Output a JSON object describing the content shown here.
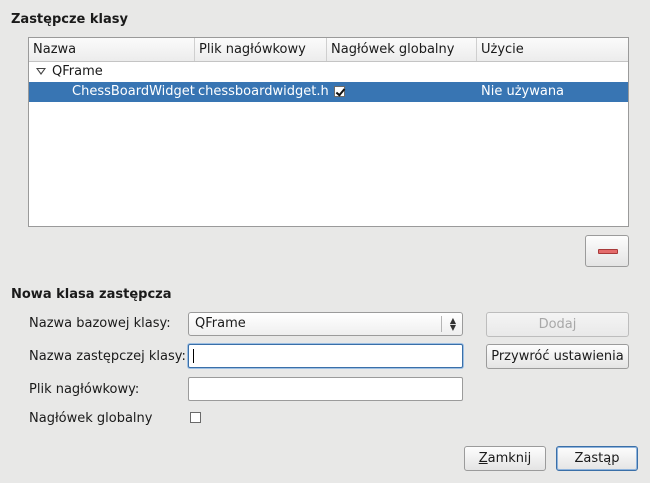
{
  "promoted_section": {
    "title": "Zastępcze klasy",
    "columns": [
      "Nazwa",
      "Plik nagłówkowy",
      "Nagłówek globalny",
      "Użycie"
    ],
    "group": {
      "name": "QFrame"
    },
    "rows": [
      {
        "name": "ChessBoardWidget",
        "header": "chessboardwidget.h",
        "global_include": true,
        "usage": "Nie używana"
      }
    ],
    "selection_color": "#3875b3"
  },
  "new_section": {
    "title": "Nowa klasa zastępcza",
    "base_class_label": "Nazwa bazowej klasy:",
    "base_class_value": "QFrame",
    "promoted_class_label": "Nazwa zastępczej klasy:",
    "promoted_class_value": "",
    "header_file_label": "Plik nagłówkowy:",
    "header_file_value": "",
    "global_include_label": "Nagłówek globalny",
    "global_include_checked": false,
    "add_label": "Dodaj",
    "reset_label": "Przywróć ustawienia"
  },
  "footer": {
    "close_mnemonic": "Z",
    "close_rest": "amknij",
    "promote_label": "Zastąp"
  },
  "icons": {
    "remove": "minus-icon",
    "expand": "collapse-triangle-icon",
    "combo": "updown-chevron-icon"
  }
}
